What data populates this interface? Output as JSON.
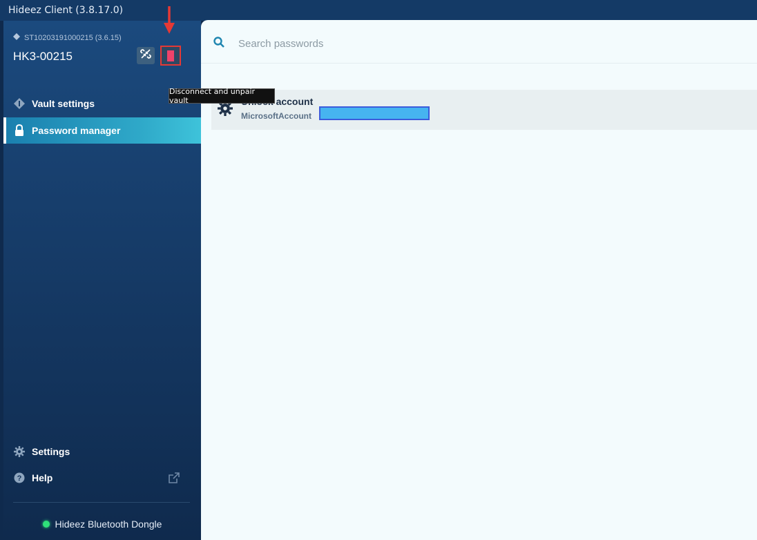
{
  "app": {
    "title": "Hideez Client (3.8.17.0)"
  },
  "device": {
    "serial": "ST10203191000215 (3.6.15)",
    "name": "HK3-00215",
    "tooltip": "Disconnect and unpair vault"
  },
  "nav": {
    "items": [
      {
        "label": "Vault settings",
        "icon": "vault-icon",
        "active": false
      },
      {
        "label": "Password manager",
        "icon": "lock-icon",
        "active": true
      }
    ],
    "bottom": [
      {
        "label": "Settings",
        "icon": "gear-icon"
      },
      {
        "label": "Help",
        "icon": "help-icon"
      }
    ]
  },
  "status": {
    "dongle": "Hideez Bluetooth Dongle",
    "color": "#2fe07a"
  },
  "search": {
    "placeholder": "Search passwords",
    "value": ""
  },
  "entries": [
    {
      "title": "Unlock account",
      "subtitle": "MicrosoftAccount",
      "icon": "gear-icon"
    }
  ],
  "colors": {
    "accent": "#2fa9c9",
    "sidebar": "#173e6c",
    "highlight": "#e53935"
  }
}
